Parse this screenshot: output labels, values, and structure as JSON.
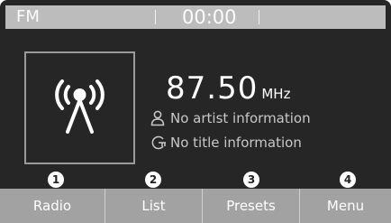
{
  "status_bar": {
    "mode": "FM",
    "clock": "00:00"
  },
  "station": {
    "frequency": "87.50",
    "unit": "MHz",
    "artist": "No artist information",
    "title": "No title information",
    "art_icon": "radio-tower-icon"
  },
  "markers": [
    "1",
    "2",
    "3",
    "4"
  ],
  "soft_keys": [
    {
      "label": "Radio"
    },
    {
      "label": "List"
    },
    {
      "label": "Presets"
    },
    {
      "label": "Menu"
    }
  ],
  "colors": {
    "background": "#262626",
    "status_bar": "#bcbcbc",
    "soft_key": "#a2a2a2",
    "text": "#ffffff"
  }
}
